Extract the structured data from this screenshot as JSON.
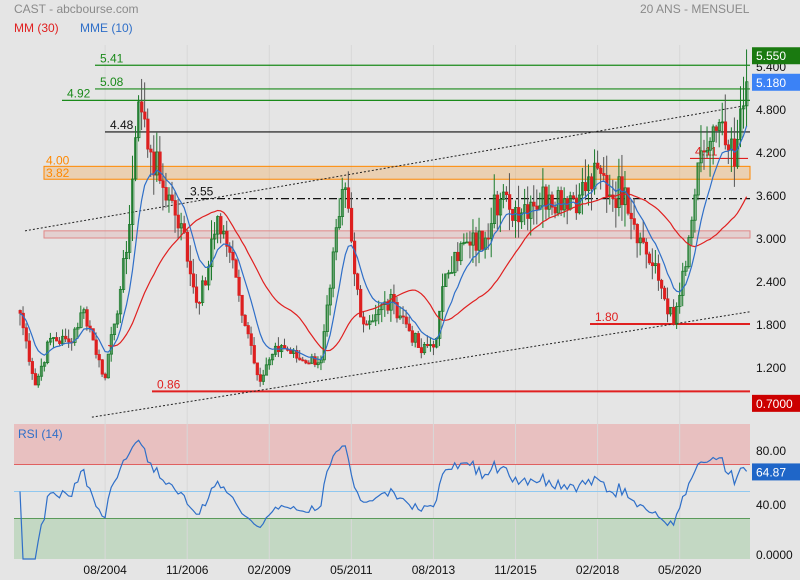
{
  "header": {
    "title": "CAST - abcbourse.com",
    "period": "20 ANS - MENSUEL"
  },
  "legend": {
    "mm": "MM (30)",
    "mme": "MME (10)",
    "rsi": "RSI (14)"
  },
  "colors": {
    "up": "#1a7a2a",
    "down": "#dd2020",
    "mm": "#e02020",
    "mme": "#2f6fc8",
    "background": "#e5e5e5"
  },
  "chart_data": [
    {
      "type": "candlestick",
      "title": "CAST - 20 ANS - MENSUEL",
      "x_tick_labels": [
        "08/2004",
        "11/2006",
        "02/2009",
        "05/2011",
        "08/2013",
        "11/2015",
        "02/2018",
        "05/2020"
      ],
      "x_tick_month_index": [
        28,
        55,
        82,
        109,
        136,
        163,
        190,
        217
      ],
      "y_tick_labels": [
        "5.400",
        "4.800",
        "4.200",
        "3.600",
        "3.000",
        "2.400",
        "1.800",
        "1.200"
      ],
      "y_ticks": [
        5.4,
        4.8,
        4.2,
        3.6,
        3.0,
        2.4,
        1.8,
        1.2
      ],
      "ylim": [
        0.6,
        5.65
      ],
      "months": 240,
      "close_keypoints": [
        [
          0,
          1.95
        ],
        [
          5,
          0.95
        ],
        [
          10,
          1.6
        ],
        [
          16,
          1.55
        ],
        [
          21,
          2.0
        ],
        [
          26,
          1.3
        ],
        [
          28,
          1.05
        ],
        [
          31,
          1.8
        ],
        [
          35,
          2.8
        ],
        [
          38,
          4.4
        ],
        [
          39,
          4.9
        ],
        [
          43,
          4.2
        ],
        [
          46,
          3.8
        ],
        [
          49,
          3.6
        ],
        [
          53,
          3.2
        ],
        [
          56,
          2.5
        ],
        [
          59,
          2.1
        ],
        [
          62,
          2.6
        ],
        [
          65,
          3.3
        ],
        [
          69,
          2.8
        ],
        [
          72,
          2.2
        ],
        [
          76,
          1.5
        ],
        [
          79,
          1.0
        ],
        [
          82,
          1.3
        ],
        [
          86,
          1.5
        ],
        [
          92,
          1.3
        ],
        [
          99,
          1.3
        ],
        [
          102,
          2.3
        ],
        [
          105,
          3.3
        ],
        [
          107,
          3.7
        ],
        [
          110,
          2.5
        ],
        [
          113,
          1.8
        ],
        [
          118,
          2.0
        ],
        [
          123,
          2.1
        ],
        [
          127,
          1.8
        ],
        [
          132,
          1.4
        ],
        [
          137,
          1.6
        ],
        [
          140,
          2.5
        ],
        [
          143,
          2.8
        ],
        [
          148,
          2.9
        ],
        [
          153,
          3.0
        ],
        [
          156,
          3.6
        ],
        [
          161,
          3.4
        ],
        [
          168,
          3.5
        ],
        [
          174,
          3.6
        ],
        [
          184,
          3.6
        ],
        [
          191,
          3.9
        ],
        [
          194,
          3.6
        ],
        [
          199,
          3.7
        ],
        [
          204,
          3.0
        ],
        [
          211,
          2.3
        ],
        [
          215,
          1.8
        ],
        [
          219,
          2.6
        ],
        [
          222,
          3.6
        ],
        [
          225,
          4.2
        ],
        [
          229,
          4.5
        ],
        [
          232,
          4.3
        ],
        [
          235,
          4.0
        ],
        [
          239,
          5.18
        ]
      ],
      "indicators": [
        {
          "name": "MM (30)",
          "period": 30,
          "kind": "sma"
        },
        {
          "name": "MME (10)",
          "period": 10,
          "kind": "ema"
        }
      ],
      "price_levels": [
        {
          "label": "5.41",
          "value": 5.41,
          "color": "#1a8a1a"
        },
        {
          "label": "5.08",
          "value": 5.08,
          "color": "#1a8a1a"
        },
        {
          "label": "4.92",
          "value": 4.92,
          "color": "#1a8a1a"
        },
        {
          "label": "4.48",
          "value": 4.48,
          "color": "#111111"
        },
        {
          "label": "3.55",
          "value": 3.55,
          "color": "#111111"
        },
        {
          "label": "4.11",
          "value": 4.11,
          "color": "#e02020"
        },
        {
          "label": "1.80",
          "value": 1.8,
          "color": "#e02020"
        },
        {
          "label": "0.86",
          "value": 0.86,
          "color": "#e02020"
        }
      ],
      "zones": [
        {
          "label_top": "4.00",
          "label_bottom": "3.82",
          "top": 4.0,
          "bottom": 3.82,
          "color": "#ff8800"
        },
        {
          "top": 3.1,
          "bottom": 3.0,
          "color": "#e08888"
        }
      ],
      "trendlines": [
        {
          "from": [
            0,
            3.1
          ],
          "to": [
            239,
            4.85
          ],
          "style": "dotted"
        },
        {
          "from": [
            22,
            0.5
          ],
          "to": [
            240,
            1.97
          ],
          "style": "dotted"
        }
      ],
      "axis_badges": [
        {
          "label": "5.550",
          "value": 5.55,
          "color": "#1a7a10"
        },
        {
          "label": "5.180",
          "value": 5.18,
          "color": "#3b82f6"
        },
        {
          "label": "0.7000",
          "value": 0.7,
          "color": "#cc0000"
        }
      ]
    },
    {
      "type": "line",
      "title": "RSI (14)",
      "ylim": [
        0,
        100
      ],
      "y_tick_labels": [
        "80.00",
        "40.00",
        "0.0000"
      ],
      "y_ticks": [
        80,
        40,
        0
      ],
      "overbought": 70,
      "midline": 50,
      "oversold": 30,
      "last_value_label": "64.87",
      "last_value": 64.87
    }
  ]
}
